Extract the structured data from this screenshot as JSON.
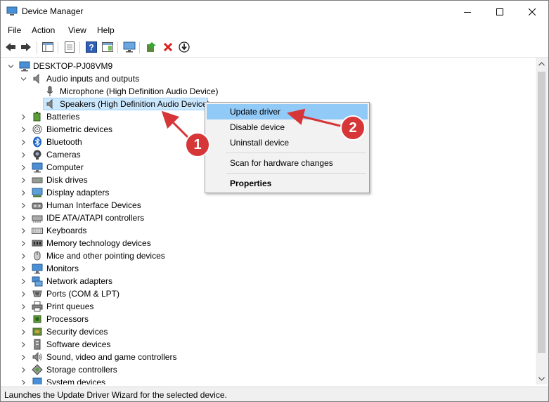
{
  "window": {
    "title": "Device Manager"
  },
  "menu": [
    "File",
    "Action",
    "View",
    "Help"
  ],
  "tree": {
    "root": "DESKTOP-PJ08VM9",
    "audio": {
      "label": "Audio inputs and outputs",
      "children": [
        "Microphone (High Definition Audio Device)",
        "Speakers (High Definition Audio Device)"
      ]
    },
    "categories": [
      {
        "label": "Batteries",
        "icon": "battery-icon"
      },
      {
        "label": "Biometric devices",
        "icon": "biometric-icon"
      },
      {
        "label": "Bluetooth",
        "icon": "bluetooth-icon"
      },
      {
        "label": "Cameras",
        "icon": "camera-icon"
      },
      {
        "label": "Computer",
        "icon": "computer-icon"
      },
      {
        "label": "Disk drives",
        "icon": "disk-drive-icon"
      },
      {
        "label": "Display adapters",
        "icon": "display-adapter-icon"
      },
      {
        "label": "Human Interface Devices",
        "icon": "hid-icon"
      },
      {
        "label": "IDE ATA/ATAPI controllers",
        "icon": "ide-controller-icon"
      },
      {
        "label": "Keyboards",
        "icon": "keyboard-icon"
      },
      {
        "label": "Memory technology devices",
        "icon": "memory-icon"
      },
      {
        "label": "Mice and other pointing devices",
        "icon": "mouse-icon"
      },
      {
        "label": "Monitors",
        "icon": "monitor-icon"
      },
      {
        "label": "Network adapters",
        "icon": "network-adapter-icon"
      },
      {
        "label": "Ports (COM & LPT)",
        "icon": "port-icon"
      },
      {
        "label": "Print queues",
        "icon": "printer-icon"
      },
      {
        "label": "Processors",
        "icon": "processor-icon"
      },
      {
        "label": "Security devices",
        "icon": "security-device-icon"
      },
      {
        "label": "Software devices",
        "icon": "software-device-icon"
      },
      {
        "label": "Sound, video and game controllers",
        "icon": "sound-controller-icon"
      },
      {
        "label": "Storage controllers",
        "icon": "storage-controller-icon"
      },
      {
        "label": "System devices",
        "icon": "system-device-icon"
      }
    ]
  },
  "context_menu": {
    "update": "Update driver",
    "disable": "Disable device",
    "uninstall": "Uninstall device",
    "scan": "Scan for hardware changes",
    "properties": "Properties"
  },
  "callouts": [
    "1",
    "2"
  ],
  "status": "Launches the Update Driver Wizard for the selected device.",
  "colors": {
    "highlight": "#91c9f7",
    "callout": "#d63638",
    "selection": "#cce8ff"
  }
}
